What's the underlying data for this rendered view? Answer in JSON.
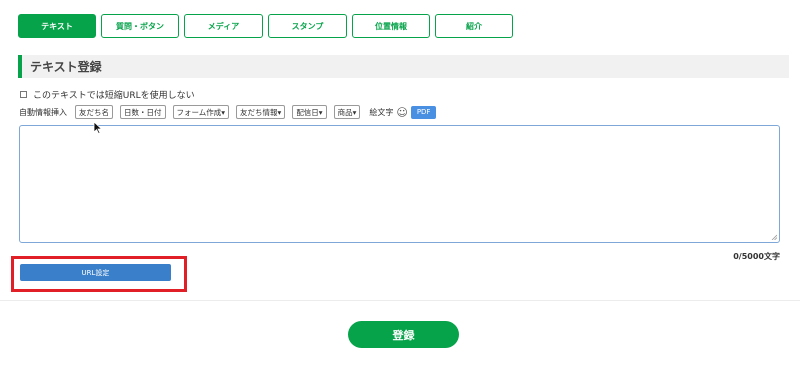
{
  "tabs": [
    {
      "label": "テキスト",
      "active": true
    },
    {
      "label": "質問・ボタン",
      "active": false
    },
    {
      "label": "メディア",
      "active": false
    },
    {
      "label": "スタンプ",
      "active": false
    },
    {
      "label": "位置情報",
      "active": false
    },
    {
      "label": "紹介",
      "active": false
    }
  ],
  "section": {
    "title": "テキスト登録"
  },
  "short_url": {
    "label": "このテキストでは短縮URLを使用しない",
    "checked": false
  },
  "auto_insert": {
    "label": "自動情報挿入",
    "chips": [
      "友だち名",
      "日数・日付",
      "フォーム作成▾",
      "友だち情報▾",
      "配信日▾",
      "商品▾"
    ],
    "emoji_label": "絵文字",
    "emoji_icon": "☺",
    "pdf_label": "PDF"
  },
  "textarea": {
    "value": ""
  },
  "counter": "0/5000文字",
  "url_button": {
    "label": "URL設定"
  },
  "register_button": {
    "label": "登録"
  },
  "colors": {
    "accent": "#06a34a",
    "link_blue": "#3a7fc9",
    "highlight_red": "#e01f26"
  }
}
